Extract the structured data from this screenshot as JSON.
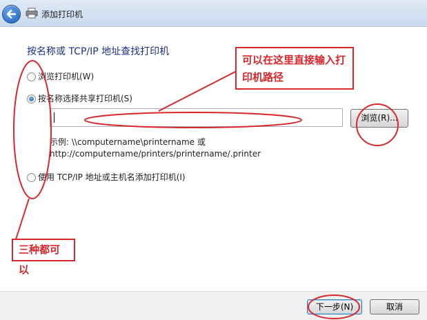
{
  "window": {
    "title": "添加打印机",
    "back_icon": "back-arrow-icon",
    "printer_icon": "printer-icon"
  },
  "main": {
    "heading": "按名称或 TCP/IP 地址查找打印机",
    "options": [
      {
        "label": "浏览打印机(W)",
        "checked": false
      },
      {
        "label": "按名称选择共享打印机(S)",
        "checked": true
      },
      {
        "label": "使用 TCP/IP 地址或主机名添加打印机(I)",
        "checked": false
      }
    ],
    "name_input": {
      "value": "",
      "placeholder": ""
    },
    "browse_button": "浏览(R)...",
    "example_line1": "示例: \\\\computername\\printername 或",
    "example_line2": "http://computername/printers/printername/.printer"
  },
  "footer": {
    "next_button": "下一步(N)",
    "cancel_button": "取消"
  },
  "annotations": {
    "callout_input": "可以在这里直接输入打印机路径",
    "callout_options": "三种都可以",
    "color": "#d9262d"
  }
}
